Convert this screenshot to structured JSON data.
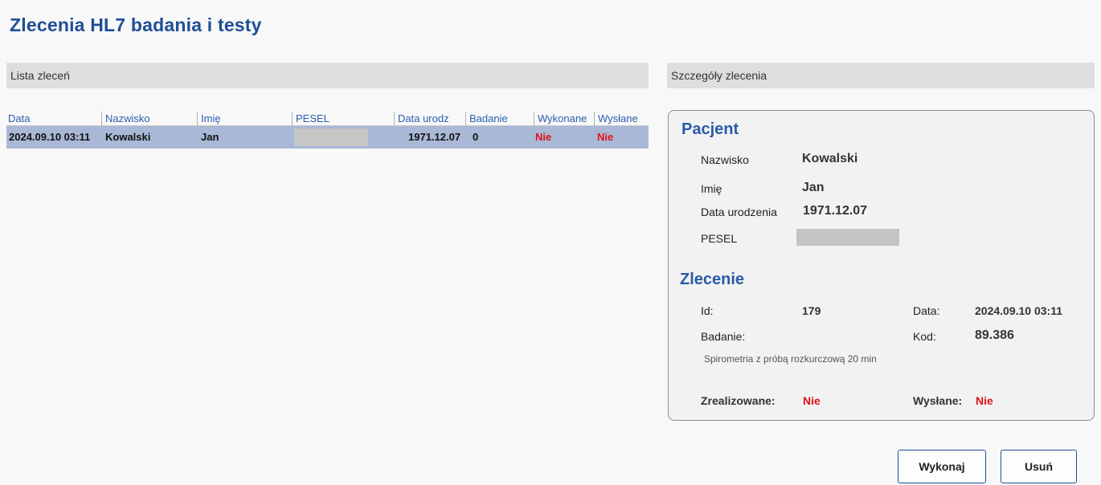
{
  "title": "Zlecenia HL7 badania i testy",
  "sections": {
    "list": "Lista zleceń",
    "details": "Szczegóły zlecenia"
  },
  "table": {
    "headers": [
      "Data",
      "Nazwisko",
      "Imię",
      "PESEL",
      "Data urodz",
      "Badanie",
      "Wykonane",
      "Wysłane"
    ],
    "rows": [
      {
        "data": "2024.09.10 03:11",
        "nazwisko": "Kowalski",
        "imie": "Jan",
        "pesel": "",
        "data_urodz": "1971.12.07",
        "badanie": "0",
        "wykonane": "Nie",
        "wyslane": "Nie"
      }
    ]
  },
  "details": {
    "patient_heading": "Pacjent",
    "nazwisko_label": "Nazwisko",
    "nazwisko": "Kowalski",
    "imie_label": "Imię",
    "imie": "Jan",
    "dob_label": "Data urodzenia",
    "dob": "1971.12.07",
    "pesel_label": "PESEL",
    "order_heading": "Zlecenie",
    "id_label": "Id:",
    "id": "179",
    "data_label": "Data:",
    "data": "2024.09.10 03:11",
    "badanie_label": "Badanie:",
    "kod_label": "Kod:",
    "kod": "89.386",
    "badanie_desc": "Spirometria z próbą rozkurczową 20 min",
    "zrealizowane_label": "Zrealizowane:",
    "zrealizowane": "Nie",
    "wyslane_label": "Wysłane:",
    "wyslane": "Nie"
  },
  "buttons": {
    "execute": "Wykonaj",
    "delete": "Usuń"
  },
  "colors": {
    "accent": "#1f4e96",
    "negative": "#e0121b",
    "selected_row": "#a9b8d6"
  }
}
